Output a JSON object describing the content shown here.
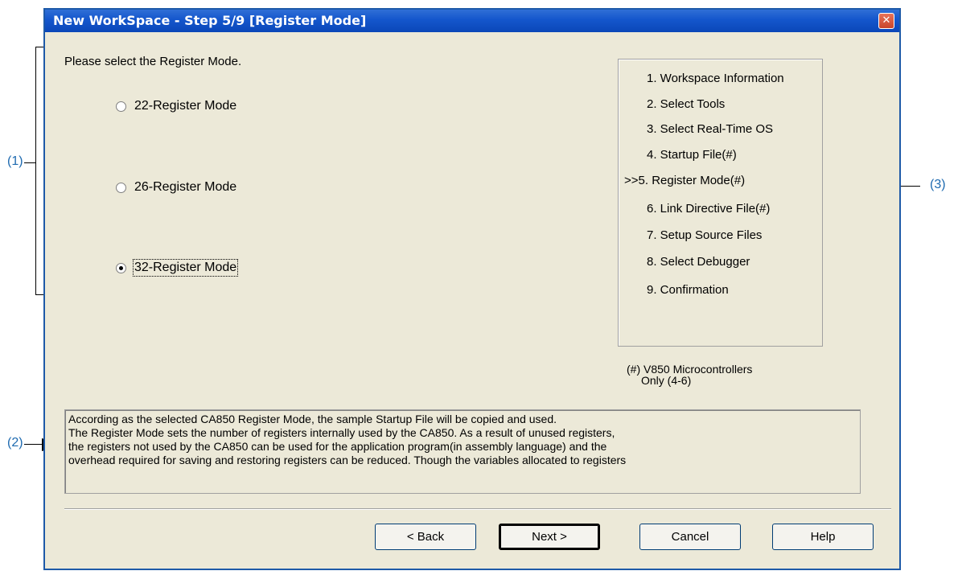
{
  "window": {
    "title": "New WorkSpace - Step 5/9 [Register Mode]",
    "close_icon": "close-icon",
    "accent": "#0a47b8"
  },
  "prompt": "Please select the Register Mode.",
  "radios": [
    {
      "label": "22-Register Mode",
      "checked": false
    },
    {
      "label": "26-Register Mode",
      "checked": false
    },
    {
      "label": "32-Register Mode",
      "checked": true
    }
  ],
  "steps": [
    "1. Workspace Information",
    "2. Select Tools",
    "3. Select Real-Time OS",
    "4. Startup File(#)",
    ">>5. Register Mode(#)",
    "6. Link Directive File(#)",
    "7. Setup Source Files",
    "8. Select Debugger",
    "9. Confirmation"
  ],
  "steps_note_line1": "(#) V850 Microcontrollers",
  "steps_note_line2": "Only (4-6)",
  "description": "According as the selected CA850 Register Mode, the sample Startup File will be copied and used.\nThe Register Mode sets the number of registers internally used by the CA850. As a result of unused registers,\nthe registers not used by the CA850 can be used for the application program(in assembly language) and the\noverhead required for saving and restoring registers can be reduced. Though the variables allocated to registers",
  "buttons": {
    "back": "< Back",
    "next": "Next >",
    "cancel": "Cancel",
    "help": "Help"
  },
  "annotations": {
    "a1": "(1)",
    "a2": "(2)",
    "a3": "(3)"
  }
}
